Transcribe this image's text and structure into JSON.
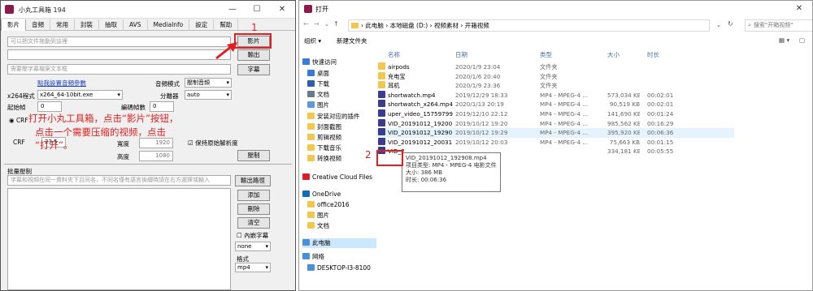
{
  "left_app": {
    "title": "小丸工具箱 194",
    "menu": [
      "影片",
      "音頻",
      "常用",
      "封裝",
      "抽取",
      "AVS",
      "MediaInfo",
      "設定",
      "幫助"
    ],
    "video_input_placeholder": "可以把文件拖動到這裡",
    "video_button": "影片",
    "output_button": "輸出",
    "subtitle_placeholder": "需要壓字幕檔案文本框",
    "subtitle_button": "字幕",
    "audio_params_link": "點我設置音頻參數",
    "audio_mode_label": "音頻模式",
    "audio_mode_value": "壓制音頻",
    "x264_label": "x264程式",
    "x264_value": "x264_64-10bit.exe",
    "splitter_label": "分離器",
    "splitter_value": "auto",
    "start_frame_label": "起始幀",
    "start_frame_value": "0",
    "encode_frames_label": "編碼幀數",
    "encode_frames_value": "0",
    "crf_radio": "CRF",
    "crf_label": "CRF",
    "crf_value": "23.5",
    "width_label": "寬度",
    "width_value": "1920",
    "height_label": "高度",
    "height_value": "1080",
    "keep_res_label": "保持原始解析度",
    "encode_button": "壓制",
    "batch_label": "批量壓制",
    "batch_placeholder": "字幕和視頻在同一資料夾下且同名，不同名僅有語言後綴時請在右方選擇或輸入",
    "output_path_button": "輸出路徑",
    "add_button": "添加",
    "delete_button": "刪除",
    "clear_button": "清空",
    "embed_subtitle_label": "內嵌字幕",
    "subtitle_select": "none",
    "format_label": "格式",
    "format_select": "mp4"
  },
  "annotations": {
    "step1_number": "1",
    "step1_text_line1": "打开小丸工具箱，点击“影片”按钮，",
    "step1_text_line2": "点击一个需要压缩的视频，点击",
    "step1_text_line3": "“打开”。",
    "step2_number": "2",
    "accent_color": "#e02020"
  },
  "file_dialog": {
    "title": "打开",
    "breadcrumb": [
      "此电脑",
      "本地磁盘 (D:)",
      "视频素材",
      "开箱视频"
    ],
    "search_placeholder": "搜索\"开箱视频\"",
    "organize_label": "组织 ▾",
    "new_folder_label": "新建文件夹",
    "columns": [
      "名称",
      "日期",
      "类型",
      "大小",
      "时长"
    ],
    "nav": [
      {
        "label": "快速访问",
        "icon": "star-icon"
      },
      {
        "label": "桌面",
        "icon": "desktop-icon"
      },
      {
        "label": "下载",
        "icon": "download-icon"
      },
      {
        "label": "文档",
        "icon": "document-icon"
      },
      {
        "label": "图片",
        "icon": "picture-icon"
      },
      {
        "label": "安装对应的插件",
        "icon": "folder-icon"
      },
      {
        "label": "封面截图",
        "icon": "folder-icon"
      },
      {
        "label": "剪辑视频",
        "icon": "folder-icon"
      },
      {
        "label": "下载音乐",
        "icon": "folder-icon"
      },
      {
        "label": "转换视频",
        "icon": "folder-icon"
      },
      {
        "label": "Creative Cloud Files",
        "icon": "cloud-icon"
      },
      {
        "label": "OneDrive",
        "icon": "onedrive-icon"
      },
      {
        "label": "office2016",
        "icon": "folder-icon"
      },
      {
        "label": "图片",
        "icon": "folder-icon"
      },
      {
        "label": "文档",
        "icon": "folder-icon"
      },
      {
        "label": "此电脑",
        "icon": "computer-icon"
      },
      {
        "label": "网络",
        "icon": "network-icon"
      },
      {
        "label": "DESKTOP-I3-8100",
        "icon": "computer-icon"
      }
    ],
    "files": [
      {
        "name": "airpods",
        "date": "2020/1/9 23:04",
        "type": "文件夹",
        "size": "",
        "duration": "",
        "kind": "folder"
      },
      {
        "name": "充电宝",
        "date": "2020/1/6 20:40",
        "type": "文件夹",
        "size": "",
        "duration": "",
        "kind": "folder"
      },
      {
        "name": "耳机",
        "date": "2020/1/9 23:36",
        "type": "文件夹",
        "size": "",
        "duration": "",
        "kind": "folder"
      },
      {
        "name": "shortwatch.mp4",
        "date": "2019/12/29 18:33",
        "type": "MP4 - MPEG-4 ...",
        "size": "573,034 KB",
        "duration": "00:02:01",
        "kind": "video"
      },
      {
        "name": "shortwatch_x264.mp4",
        "date": "2020/1/13 20:19",
        "type": "MP4 - MPEG-4 ...",
        "size": "90,519 KB",
        "duration": "00:02:01",
        "kind": "video"
      },
      {
        "name": "uper_video_15759799...",
        "date": "2019/12/10 22:12",
        "type": "MP4 - MPEG-4 ...",
        "size": "141,690 KB",
        "duration": "00:01:24",
        "kind": "video"
      },
      {
        "name": "VID_20191012_19200...",
        "date": "2019/10/12 19:20",
        "type": "MP4 - MPEG-4 ...",
        "size": "985,562 KB",
        "duration": "00:16:29",
        "kind": "video"
      },
      {
        "name": "VID_20191012_19290...",
        "date": "2019/10/12 19:29",
        "type": "MP4 - MPEG-4 ...",
        "size": "395,920 KB",
        "duration": "00:06:36",
        "kind": "video"
      },
      {
        "name": "VID_20191012_20031...",
        "date": "2019/10/12 20:03",
        "type": "MP4 - MPEG-4 ...",
        "size": "75,663 KB",
        "duration": "00:01:15",
        "kind": "video"
      },
      {
        "name": "VID_2...",
        "date": "",
        "type": "",
        "size": "334,181 KB",
        "duration": "00:05:55",
        "kind": "video"
      }
    ],
    "tooltip": {
      "name": "VID_20191012_192908.mp4",
      "type": "项目类型: MP4 - MPEG-4 电影文件",
      "size": "大小: 386 MB",
      "duration": "时长: 00:06:36"
    }
  }
}
